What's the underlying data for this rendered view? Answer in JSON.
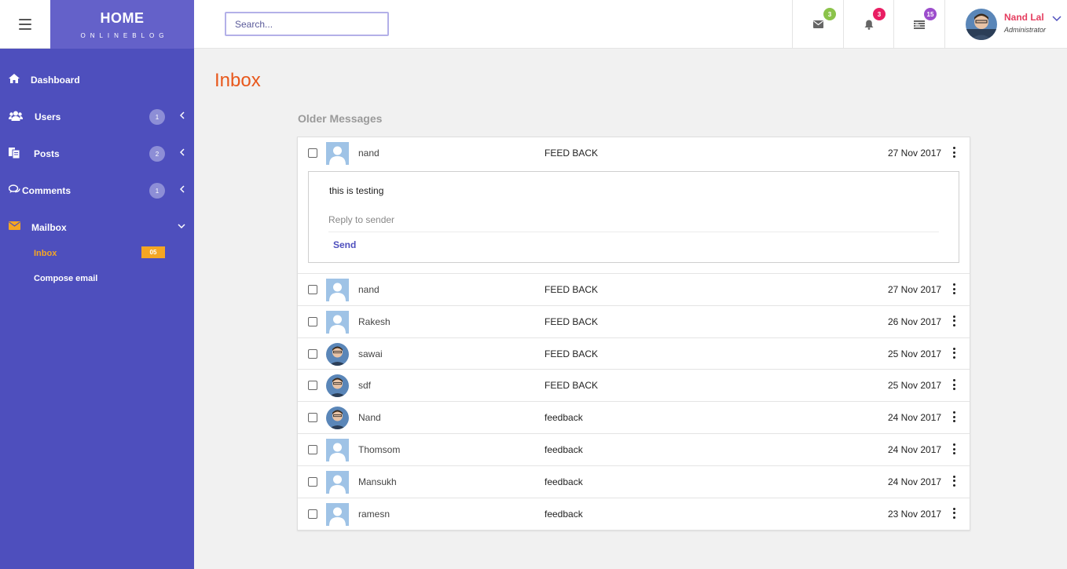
{
  "brand": {
    "title": "HOME",
    "subtitle": "ONLINEBLOG"
  },
  "search": {
    "placeholder": "Search..."
  },
  "header_icons": [
    {
      "icon": "envelope-icon",
      "count": "3",
      "color": "#8bc34a"
    },
    {
      "icon": "bell-icon",
      "count": "3",
      "color": "#e91e63"
    },
    {
      "icon": "list-icon",
      "count": "15",
      "color": "#9c4dcc"
    }
  ],
  "user": {
    "name": "Nand Lal",
    "role": "Administrator"
  },
  "sidebar": {
    "items": [
      {
        "label": "Dashboard",
        "icon": "home-icon"
      },
      {
        "label": "Users",
        "icon": "users-icon",
        "count": "1"
      },
      {
        "label": "Posts",
        "icon": "files-icon",
        "count": "2"
      },
      {
        "label": "Comments",
        "icon": "comments-icon",
        "count": "1"
      },
      {
        "label": "Mailbox",
        "icon": "envelope-icon"
      }
    ],
    "mailbox_sub": [
      {
        "label": "Inbox",
        "badge": "05"
      },
      {
        "label": "Compose email"
      }
    ]
  },
  "page": {
    "title": "Inbox",
    "section": "Older Messages"
  },
  "preview": {
    "body": "this is testing",
    "reply_placeholder": "Reply to sender",
    "send_label": "Send"
  },
  "messages": [
    {
      "sender": "nand",
      "subject": "FEED BACK",
      "date": "27 Nov 2017",
      "avatar": "placeholder"
    },
    {
      "sender": "nand",
      "subject": "FEED BACK",
      "date": "27 Nov 2017",
      "avatar": "placeholder"
    },
    {
      "sender": "Rakesh",
      "subject": "FEED BACK",
      "date": "26 Nov 2017",
      "avatar": "placeholder"
    },
    {
      "sender": "sawai",
      "subject": "FEED BACK",
      "date": "25 Nov 2017",
      "avatar": "photo"
    },
    {
      "sender": "sdf",
      "subject": "FEED BACK",
      "date": "25 Nov 2017",
      "avatar": "photo"
    },
    {
      "sender": "Nand",
      "subject": "feedback",
      "date": "24 Nov 2017",
      "avatar": "photo"
    },
    {
      "sender": "Thomsom",
      "subject": "feedback",
      "date": "24 Nov 2017",
      "avatar": "placeholder"
    },
    {
      "sender": "Mansukh",
      "subject": "feedback",
      "date": "24 Nov 2017",
      "avatar": "placeholder"
    },
    {
      "sender": "ramesn",
      "subject": "feedback",
      "date": "23 Nov 2017",
      "avatar": "placeholder"
    }
  ],
  "colors": {
    "sidebar": "#4e4fbd",
    "brand": "#6461c9",
    "accent": "#e8581c",
    "inbox_active": "#f5a623",
    "user_name": "#e53e60"
  }
}
